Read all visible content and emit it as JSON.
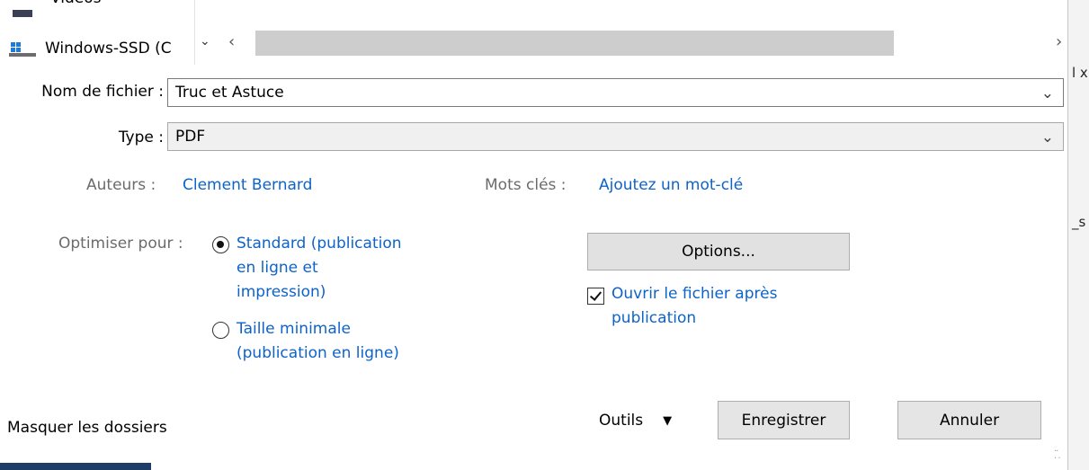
{
  "tree": {
    "top_item_label": "Vidéos",
    "drive_label": "Windows-SSD (C"
  },
  "file_name": {
    "label": "Nom de fichier :",
    "value": "Truc et Astuce"
  },
  "file_type": {
    "label": "Type :",
    "value": "PDF"
  },
  "authors": {
    "label": "Auteurs :",
    "value": "Clement Bernard"
  },
  "keywords": {
    "label": "Mots clés :",
    "value": "Ajoutez un mot-clé"
  },
  "optimize": {
    "label": "Optimiser pour :",
    "standard_line1": "Standard (publication",
    "standard_line2": "en ligne et",
    "standard_line3": "impression)",
    "minimal_line1": "Taille minimale",
    "minimal_line2": "(publication en ligne)",
    "selected": "standard"
  },
  "options_button": "Options...",
  "open_after": {
    "line1": "Ouvrir le fichier après",
    "line2": "publication",
    "checked": true
  },
  "hide_folders": "Masquer les dossiers",
  "tools": "Outils",
  "save_button": "Enregistrer",
  "cancel_button": "Annuler",
  "background_fragments": {
    "frag1": "l x",
    "frag2": "_s"
  },
  "colors": {
    "link": "#0e63c8",
    "label": "#6b6b6b",
    "accent_bar": "#1e3d66"
  }
}
